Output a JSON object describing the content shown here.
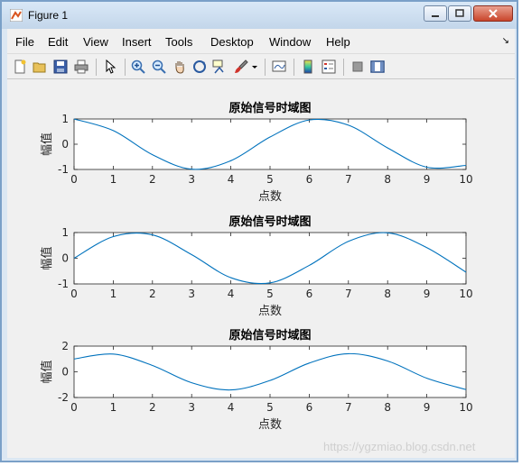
{
  "window": {
    "title": "Figure 1",
    "controls": {
      "minimize": "minimize",
      "maximize": "maximize",
      "close": "close"
    }
  },
  "menubar": {
    "items": [
      "File",
      "Edit",
      "View",
      "Insert",
      "Tools",
      "Desktop",
      "Window",
      "Help"
    ]
  },
  "toolbar": {
    "icons": [
      "new-figure-icon",
      "open-file-icon",
      "save-icon",
      "print-icon",
      "pointer-icon",
      "zoom-in-icon",
      "zoom-out-icon",
      "pan-icon",
      "rotate-3d-icon",
      "data-cursor-icon",
      "brush-icon",
      "brush-dropdown-icon",
      "link-plot-icon",
      "colorbar-icon",
      "legend-icon",
      "hide-plot-tools-icon",
      "show-plot-tools-icon"
    ]
  },
  "watermark": "https://ygzmiao.blog.csdn.net",
  "chart_data": [
    {
      "type": "line",
      "title": "原始信号时域图",
      "xlabel": "点数",
      "ylabel": "幅值",
      "xlim": [
        0,
        10
      ],
      "ylim": [
        -1,
        1
      ],
      "xticks": [
        0,
        1,
        2,
        3,
        4,
        5,
        6,
        7,
        8,
        9,
        10
      ],
      "yticks": [
        -1,
        0,
        1
      ],
      "series": [
        {
          "color": "#0072BD",
          "x": [
            0,
            1,
            2,
            3,
            4,
            5,
            6,
            7,
            8,
            9,
            10
          ],
          "y": [
            1.0,
            0.54,
            -0.416,
            -0.99,
            -0.654,
            0.284,
            0.96,
            0.754,
            -0.146,
            -0.911,
            -0.839
          ]
        }
      ]
    },
    {
      "type": "line",
      "title": "原始信号时域图",
      "xlabel": "点数",
      "ylabel": "幅值",
      "xlim": [
        0,
        10
      ],
      "ylim": [
        -1,
        1
      ],
      "xticks": [
        0,
        1,
        2,
        3,
        4,
        5,
        6,
        7,
        8,
        9,
        10
      ],
      "yticks": [
        -1,
        0,
        1
      ],
      "series": [
        {
          "color": "#0072BD",
          "x": [
            0,
            1,
            2,
            3,
            4,
            5,
            6,
            7,
            8,
            9,
            10
          ],
          "y": [
            0.0,
            0.841,
            0.909,
            0.141,
            -0.757,
            -0.959,
            -0.279,
            0.657,
            0.989,
            0.412,
            -0.544
          ]
        }
      ]
    },
    {
      "type": "line",
      "title": "原始信号时域图",
      "xlabel": "点数",
      "ylabel": "幅值",
      "xlim": [
        0,
        10
      ],
      "ylim": [
        -2,
        2
      ],
      "xticks": [
        0,
        1,
        2,
        3,
        4,
        5,
        6,
        7,
        8,
        9,
        10
      ],
      "yticks": [
        -2,
        0,
        2
      ],
      "series": [
        {
          "color": "#0072BD",
          "x": [
            0,
            1,
            2,
            3,
            4,
            5,
            6,
            7,
            8,
            9,
            10
          ],
          "y": [
            1.0,
            1.382,
            0.493,
            -0.849,
            -1.411,
            -0.675,
            0.681,
            1.411,
            0.843,
            -0.499,
            -1.383
          ]
        }
      ]
    }
  ]
}
